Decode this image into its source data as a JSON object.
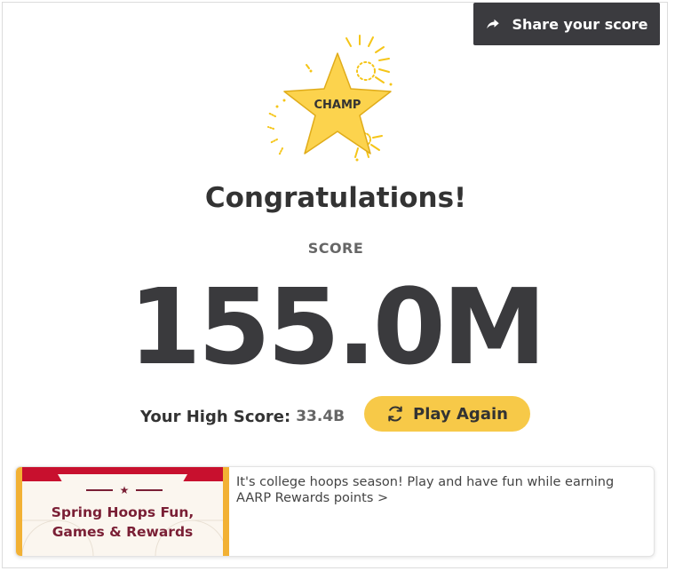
{
  "share": {
    "label": "Share your score",
    "icon": "share-icon"
  },
  "badge": {
    "label": "CHAMP",
    "icon": "champ-star-icon",
    "star_color": "#fcd34d",
    "spark_color": "#f5c518"
  },
  "results": {
    "heading": "Congratulations!",
    "score_label": "SCORE",
    "score_value": "155.0M"
  },
  "high_score": {
    "label": "Your High Score:",
    "value": "33.4B"
  },
  "play_again": {
    "label": "Play Again",
    "icon": "refresh-icon",
    "color": "#f7c948"
  },
  "promo": {
    "image_title_line1": "Spring Hoops Fun,",
    "image_title_line2": "Games & Rewards",
    "star_glyph": "★",
    "text": "It's college hoops season! Play and have fun while earning AARP Rewards points >",
    "accent_color": "#7a1f35"
  },
  "colors": {
    "share_bg": "#3b3b3f",
    "score_text": "#3a3a3d"
  }
}
